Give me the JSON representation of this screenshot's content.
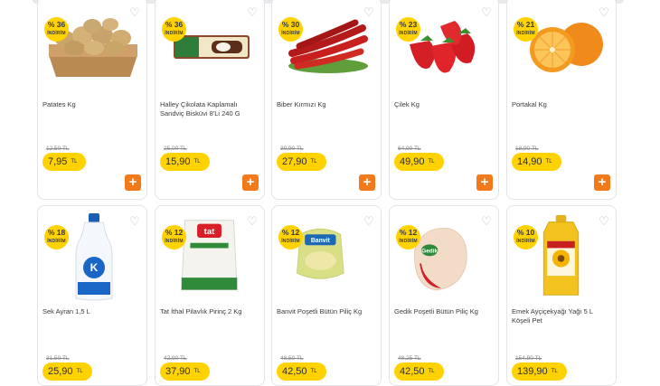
{
  "currency": "TL",
  "discount_label": "İNDİRİM",
  "products": [
    {
      "name": "Patates Kg",
      "discount": "% 36",
      "old_price": "12,50 TL",
      "price": "7,95"
    },
    {
      "name": "Halley Çikolata Kaplamalı Sandviç Bisküvi 8'Li 240 G",
      "discount": "% 36",
      "old_price": "25,00 TL",
      "price": "15,90"
    },
    {
      "name": "Biber Kırmızı Kg",
      "discount": "% 30",
      "old_price": "39,90 TL",
      "price": "27,90"
    },
    {
      "name": "Çilek Kg",
      "discount": "% 23",
      "old_price": "64,90 TL",
      "price": "49,90"
    },
    {
      "name": "Portakal Kg",
      "discount": "% 21",
      "old_price": "18,90 TL",
      "price": "14,90"
    },
    {
      "name": "Sek Ayran 1,5 L",
      "discount": "% 18",
      "old_price": "31,50 TL",
      "price": "25,90"
    },
    {
      "name": "Tat İthal Pilavlık Pirinç 2 Kg",
      "discount": "% 12",
      "old_price": "42,90 TL",
      "price": "37,90"
    },
    {
      "name": "Banvit Poşetli Bütün Piliç Kg",
      "discount": "% 12",
      "old_price": "48,50 TL",
      "price": "42,50"
    },
    {
      "name": "Gedik Poşetli Bütün Piliç Kg",
      "discount": "% 12",
      "old_price": "48,25 TL",
      "price": "42,50"
    },
    {
      "name": "Emek Ayçiçekyağı Yağı 5 L Köşeli Pet",
      "discount": "% 10",
      "old_price": "154,90 TL",
      "price": "139,90"
    }
  ],
  "icons": {
    "favorite": "heart-outline-icon",
    "add": "plus-icon"
  },
  "colors": {
    "badge": "#ffd200",
    "add_button": "#f27a1a"
  }
}
